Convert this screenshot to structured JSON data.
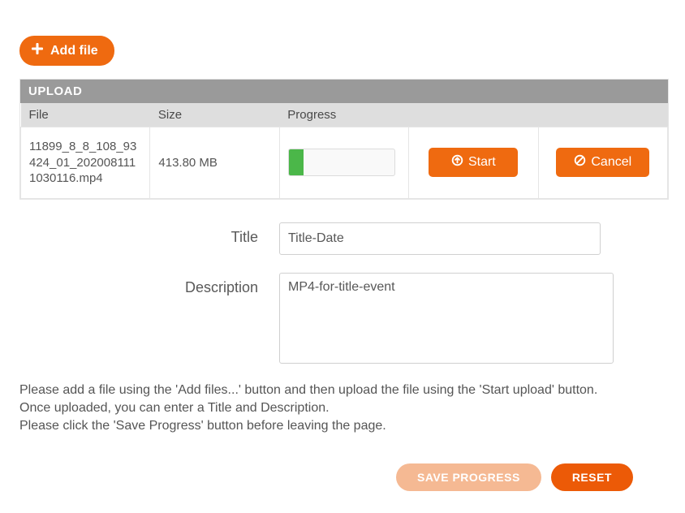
{
  "add_file_label": "Add file",
  "upload_section_title": "UPLOAD",
  "columns": {
    "file": "File",
    "size": "Size",
    "progress": "Progress"
  },
  "rows": [
    {
      "filename": "11899_8_8_108_93424_01_2020081111030116.mp4",
      "size": "413.80 MB",
      "progress_percent": 14,
      "start_label": "Start",
      "cancel_label": "Cancel"
    }
  ],
  "form": {
    "title_label": "Title",
    "title_value": "Title-Date",
    "description_label": "Description",
    "description_value": "MP4-for-title-event"
  },
  "help": {
    "line1": "Please add a file using the 'Add files...' button and then upload the file using the 'Start upload' button.",
    "line2": "Once uploaded, you can enter a Title and Description.",
    "line3": "Please click the 'Save Progress' button before leaving the page."
  },
  "actions": {
    "save_progress": "SAVE PROGRESS",
    "reset": "RESET"
  }
}
